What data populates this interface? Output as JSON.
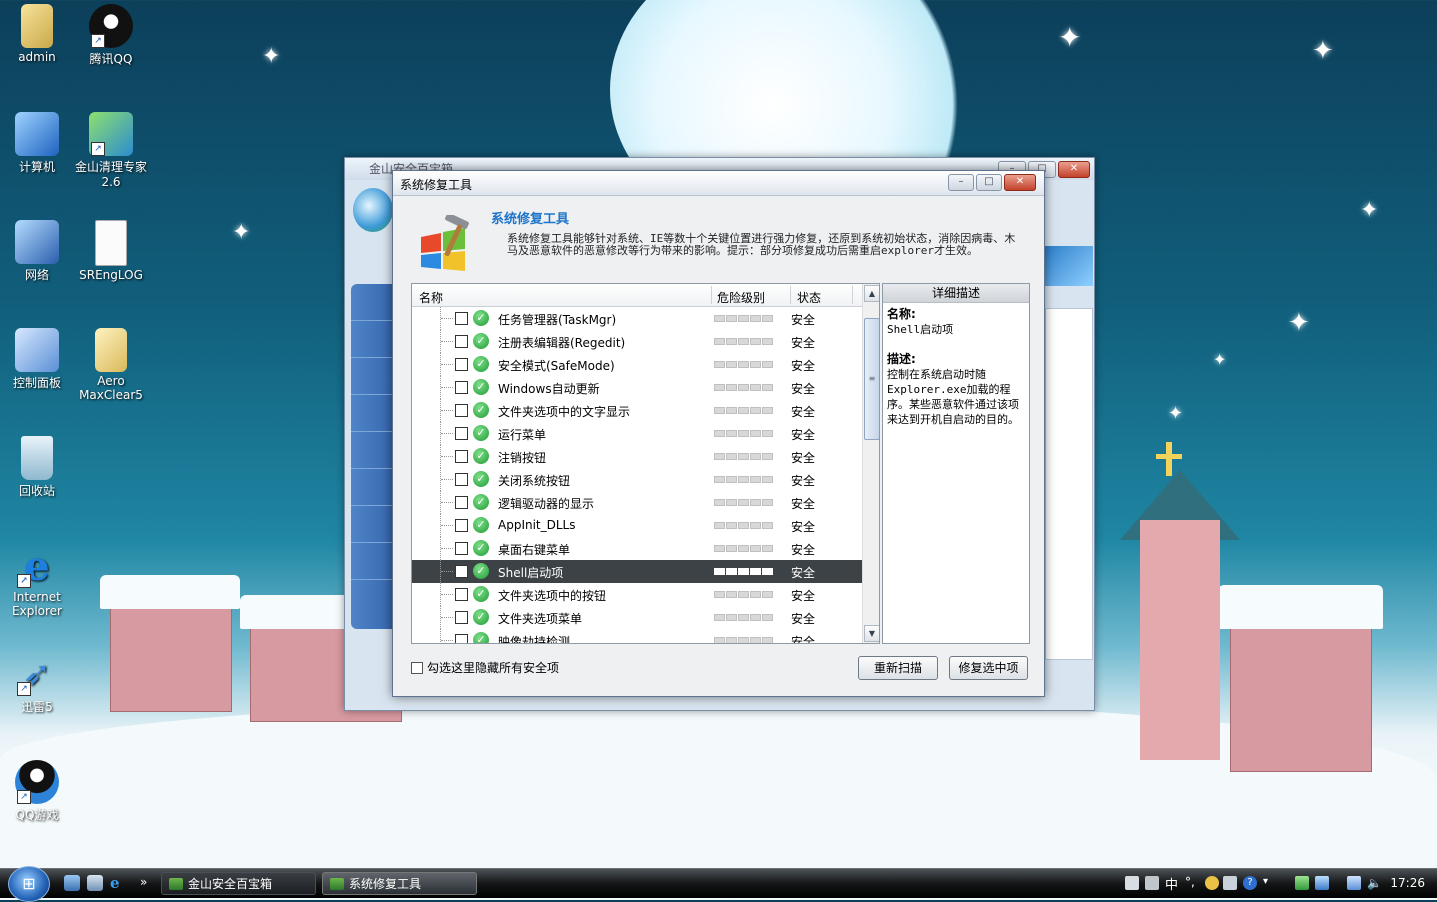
{
  "desktop": {
    "icons": [
      {
        "label": "admin"
      },
      {
        "label": "腾讯QQ"
      },
      {
        "label": "计算机"
      },
      {
        "label": "金山清理专家 2.6"
      },
      {
        "label": "网络"
      },
      {
        "label": "SREngLOG"
      },
      {
        "label": "控制面板"
      },
      {
        "label": "Aero MaxClear5"
      },
      {
        "label": "回收站"
      },
      {
        "label": "Internet Explorer"
      },
      {
        "label": "迅雷5"
      },
      {
        "label": "QQ游戏"
      }
    ]
  },
  "bg_window": {
    "title": "金山安全百宝箱"
  },
  "dialog": {
    "title": "系统修复工具",
    "header_title": "系统修复工具",
    "header_desc": "系统修复工具能够针对系统、IE等数十个关键位置进行强力修复，还原到系统初始状态，消除因病毒、木马及恶意软件的恶意修改等行为带来的影响。提示：部分项修复成功后需重启explorer才生效。",
    "columns": {
      "name": "名称",
      "risk": "危险级别",
      "status": "状态"
    },
    "rows": [
      {
        "name": "任务管理器(TaskMgr)",
        "status": "安全"
      },
      {
        "name": "注册表编辑器(Regedit)",
        "status": "安全"
      },
      {
        "name": "安全模式(SafeMode)",
        "status": "安全"
      },
      {
        "name": "Windows自动更新",
        "status": "安全"
      },
      {
        "name": "文件夹选项中的文字显示",
        "status": "安全"
      },
      {
        "name": "运行菜单",
        "status": "安全"
      },
      {
        "name": "注销按钮",
        "status": "安全"
      },
      {
        "name": "关闭系统按钮",
        "status": "安全"
      },
      {
        "name": "逻辑驱动器的显示",
        "status": "安全"
      },
      {
        "name": "AppInit_DLLs",
        "status": "安全"
      },
      {
        "name": "桌面右键菜单",
        "status": "安全"
      },
      {
        "name": "Shell启动项",
        "status": "安全",
        "selected": true
      },
      {
        "name": "文件夹选项中的按钮",
        "status": "安全"
      },
      {
        "name": "文件夹选项菜单",
        "status": "安全"
      },
      {
        "name": "映像劫持检测",
        "status": "安全"
      }
    ],
    "detail": {
      "header": "详细描述",
      "name_label": "名称:",
      "name_value": "Shell启动项",
      "desc_label": "描述:",
      "desc_value": "控制在系统启动时随Explorer.exe加载的程序。某些恶意软件通过该项来达到开机自启动的目的。"
    },
    "hide_safe_label": "勾选这里隐藏所有安全项",
    "rescan_button": "重新扫描",
    "repair_button": "修复选中项"
  },
  "taskbar": {
    "buttons": [
      {
        "label": "金山安全百宝箱"
      },
      {
        "label": "系统修复工具"
      }
    ],
    "ime": "中",
    "clock": "17:26"
  },
  "colors": {
    "accent": "#1f75c9",
    "selected_row": "#3d4247",
    "ok_green": "#1f9a35"
  }
}
